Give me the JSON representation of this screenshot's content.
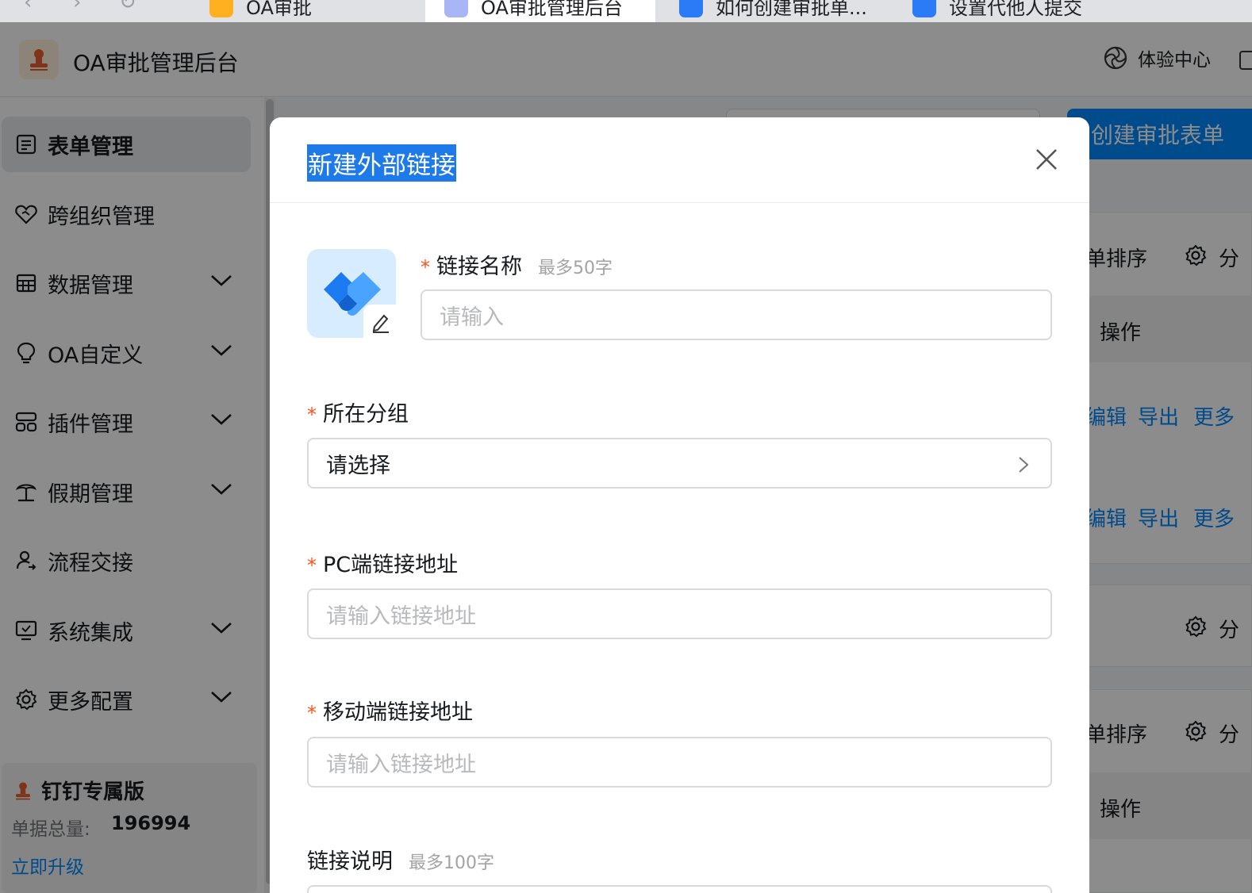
{
  "browser": {
    "tabs": [
      {
        "label": "OA审批"
      },
      {
        "label": "OA审批管理后台"
      },
      {
        "label": "如何创建审批单..."
      },
      {
        "label": "设置代他人提交"
      }
    ]
  },
  "header": {
    "app_title": "OA审批管理后台",
    "experience_center": "体验中心"
  },
  "sidebar": {
    "items": [
      {
        "label": "表单管理"
      },
      {
        "label": "跨组织管理"
      },
      {
        "label": "数据管理"
      },
      {
        "label": "OA自定义"
      },
      {
        "label": "插件管理"
      },
      {
        "label": "假期管理"
      },
      {
        "label": "流程交接"
      },
      {
        "label": "系统集成"
      },
      {
        "label": "更多配置"
      }
    ],
    "edition": {
      "title": "钉钉专属版",
      "count_label": "单据总量:",
      "count_value": "196994",
      "upgrade_link": "立即升级"
    }
  },
  "main": {
    "create_button": "创建审批表单",
    "sort_label": "单排序",
    "group_label": "分",
    "ops_header": "操作",
    "edit": "编辑",
    "export": "导出",
    "more": "更多"
  },
  "modal": {
    "title": "新建外部链接",
    "link_name": {
      "label": "链接名称",
      "hint": "最多50字",
      "placeholder": "请输入"
    },
    "group": {
      "label": "所在分组",
      "value": "请选择"
    },
    "pc_url": {
      "label": "PC端链接地址",
      "placeholder": "请输入链接地址"
    },
    "mobile_url": {
      "label": "移动端链接地址",
      "placeholder": "请输入链接地址"
    },
    "description": {
      "label": "链接说明",
      "hint": "最多100字"
    }
  },
  "colors": {
    "primary": "#0089ff",
    "required": "#ff5219",
    "mask": "rgba(0,0,0,0.45)"
  }
}
